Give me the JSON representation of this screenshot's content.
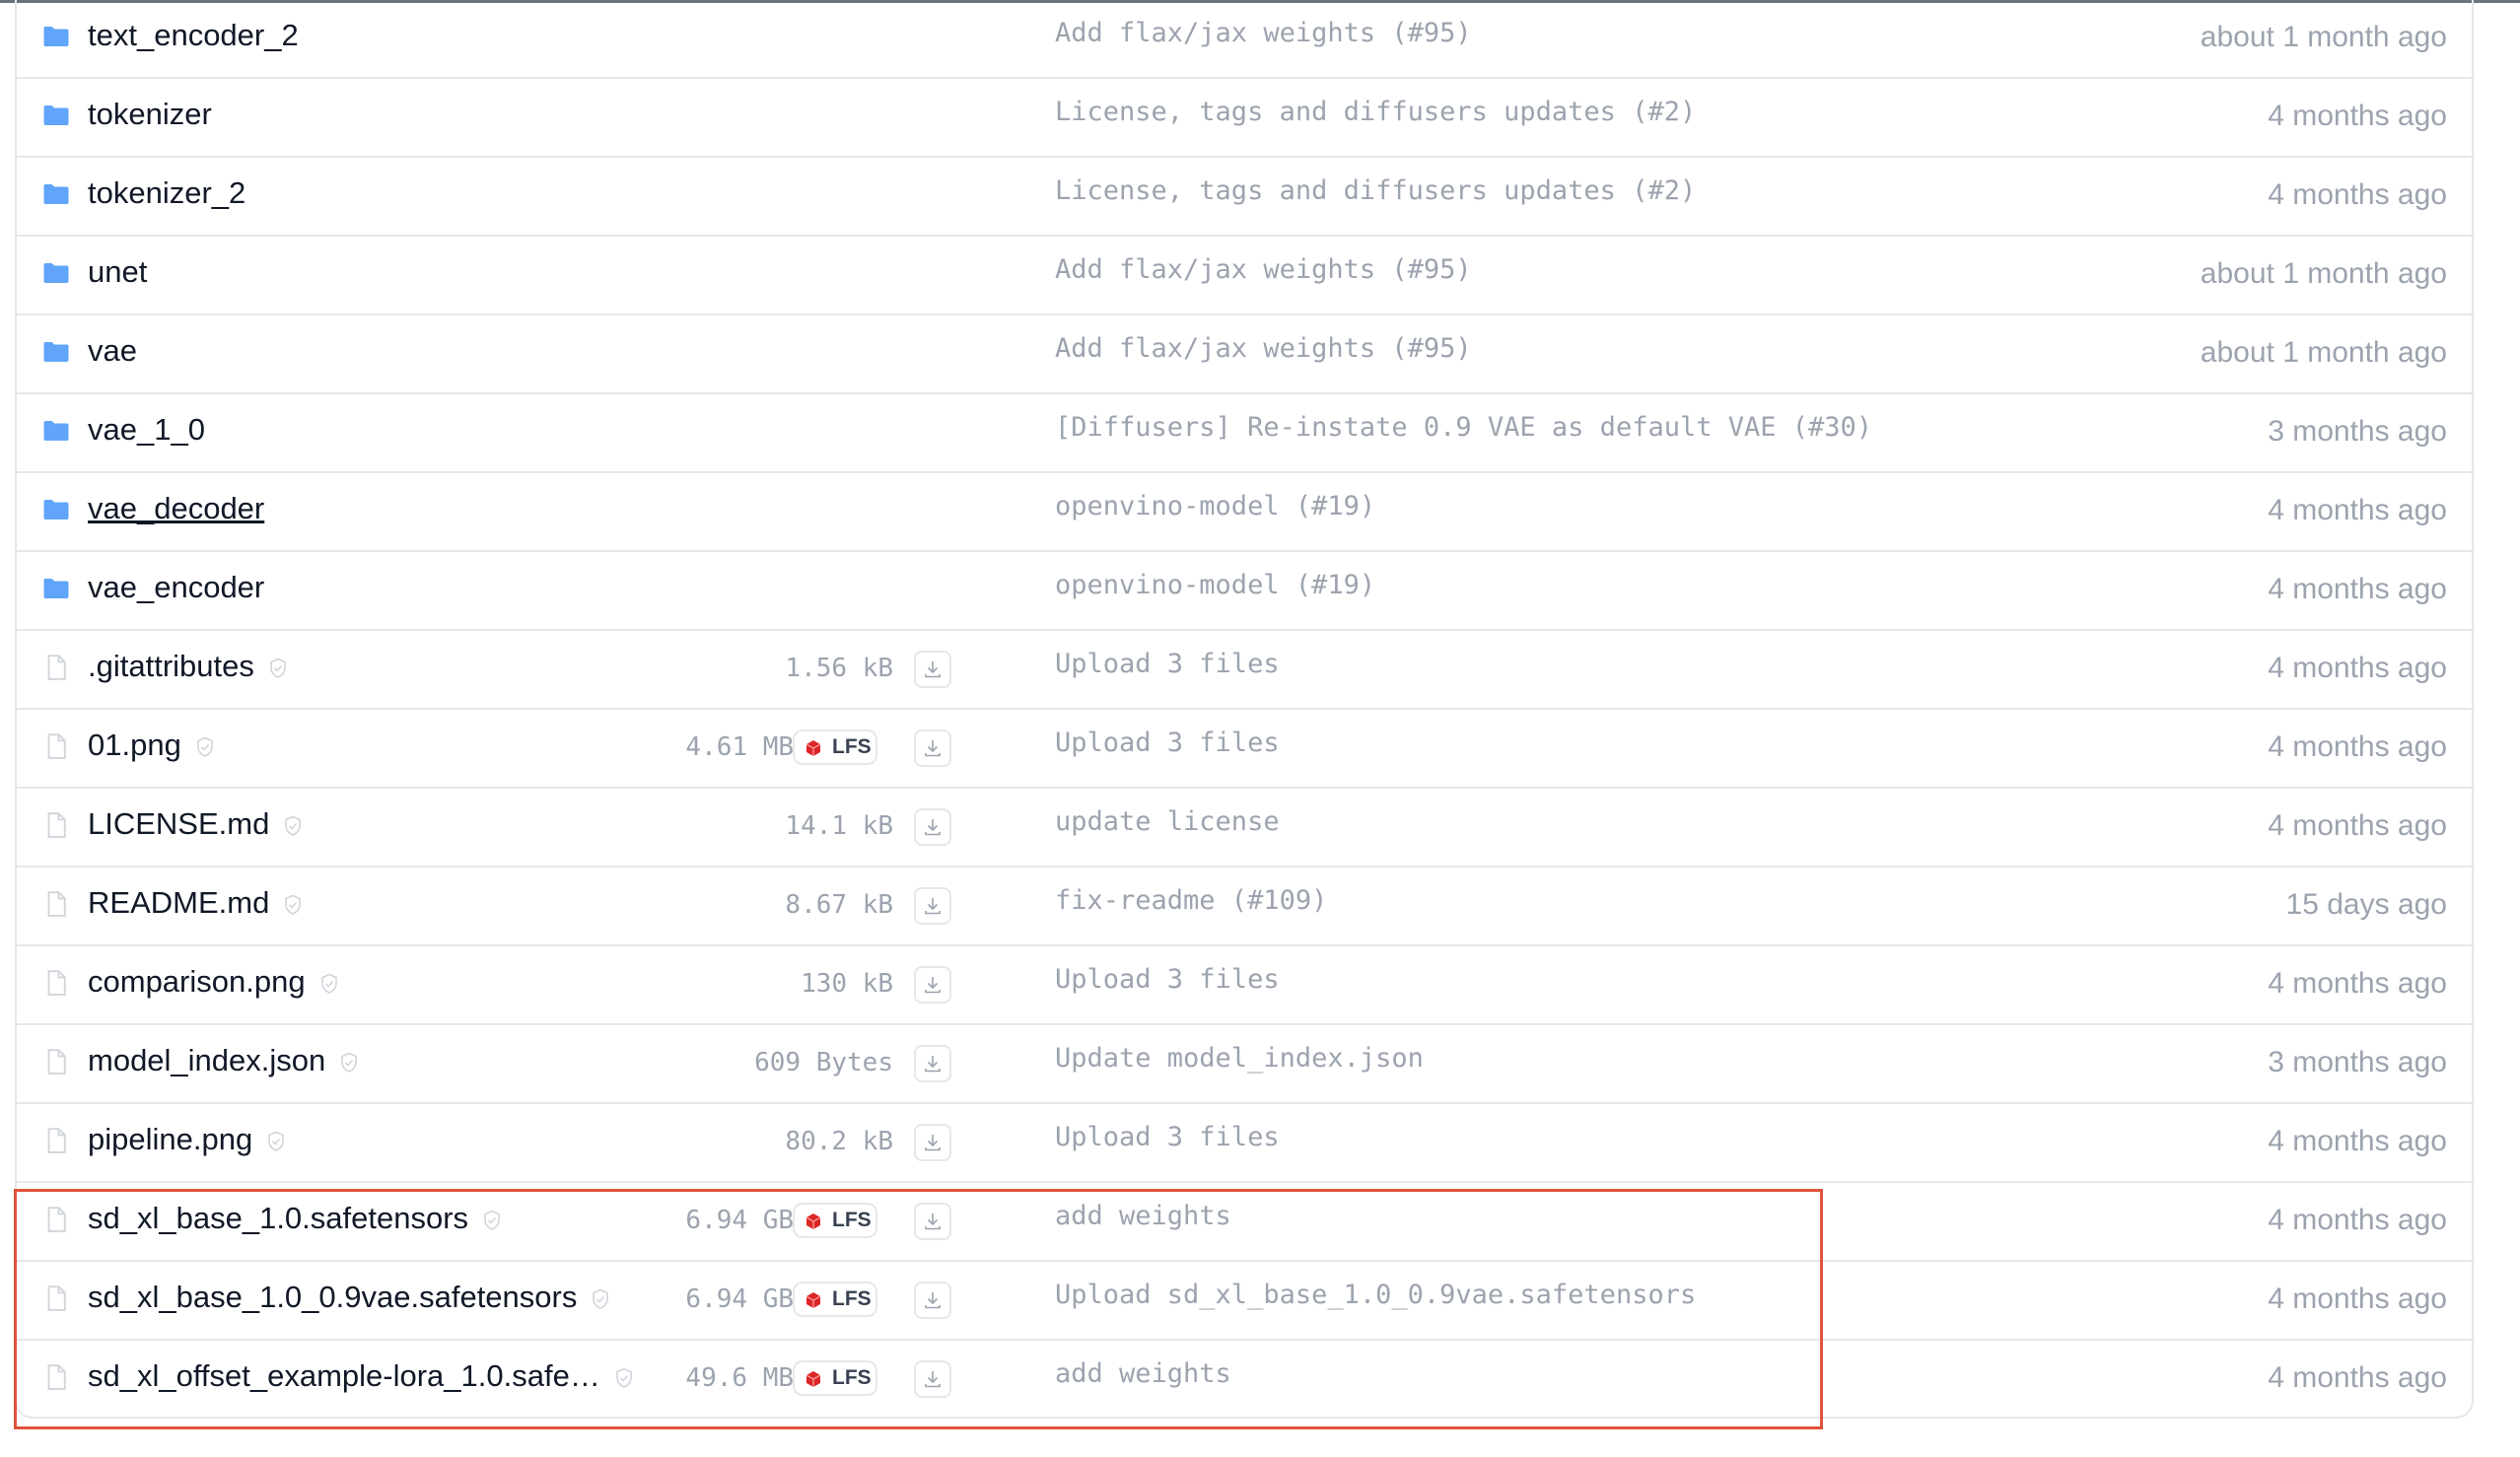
{
  "icons": {
    "folder": "folder-icon",
    "file": "file-icon",
    "shield": "shield-check-icon",
    "lfs": "lfs-icon",
    "download": "download-icon"
  },
  "colors": {
    "folder": "#60a5fa",
    "highlight": "#e0533c",
    "lfs_icon": "#dc2626"
  },
  "folders": [
    {
      "name": "text_encoder_2",
      "commit": "Add flax/jax weights (#95)",
      "time": "about 1 month ago"
    },
    {
      "name": "tokenizer",
      "commit": "License, tags and diffusers updates (#2)",
      "time": "4 months ago"
    },
    {
      "name": "tokenizer_2",
      "commit": "License, tags and diffusers updates (#2)",
      "time": "4 months ago"
    },
    {
      "name": "unet",
      "commit": "Add flax/jax weights (#95)",
      "time": "about 1 month ago"
    },
    {
      "name": "vae",
      "commit": "Add flax/jax weights (#95)",
      "time": "about 1 month ago"
    },
    {
      "name": "vae_1_0",
      "commit": "[Diffusers] Re-instate 0.9 VAE as default VAE (#30)",
      "time": "3 months ago"
    },
    {
      "name": "vae_decoder",
      "commit": "openvino-model (#19)",
      "time": "4 months ago"
    },
    {
      "name": "vae_encoder",
      "commit": "openvino-model (#19)",
      "time": "4 months ago"
    }
  ],
  "files": [
    {
      "name": ".gitattributes",
      "size": "1.56 kB",
      "lfs": false,
      "commit": "Upload 3 files",
      "time": "4 months ago"
    },
    {
      "name": "01.png",
      "size": "4.61 MB",
      "lfs": true,
      "lfs_label": "LFS",
      "commit": "Upload 3 files",
      "time": "4 months ago"
    },
    {
      "name": "LICENSE.md",
      "size": "14.1 kB",
      "lfs": false,
      "commit": "update license",
      "time": "4 months ago"
    },
    {
      "name": "README.md",
      "size": "8.67 kB",
      "lfs": false,
      "commit": "fix-readme (#109)",
      "time": "15 days ago"
    },
    {
      "name": "comparison.png",
      "size": "130 kB",
      "lfs": false,
      "commit": "Upload 3 files",
      "time": "4 months ago"
    },
    {
      "name": "model_index.json",
      "size": "609 Bytes",
      "lfs": false,
      "commit": "Update model_index.json",
      "time": "3 months ago"
    },
    {
      "name": "pipeline.png",
      "size": "80.2 kB",
      "lfs": false,
      "commit": "Upload 3 files",
      "time": "4 months ago"
    },
    {
      "name": "sd_xl_base_1.0.safetensors",
      "size": "6.94 GB",
      "lfs": true,
      "lfs_label": "LFS",
      "commit": "add weights",
      "time": "4 months ago"
    },
    {
      "name": "sd_xl_base_1.0_0.9vae.safetensors",
      "size": "6.94 GB",
      "lfs": true,
      "lfs_label": "LFS",
      "commit": "Upload sd_xl_base_1.0_0.9vae.safetensors",
      "time": "4 months ago"
    },
    {
      "name": "sd_xl_offset_example-lora_1.0.safe…",
      "size": "49.6 MB",
      "lfs": true,
      "lfs_label": "LFS",
      "commit": "add weights",
      "time": "4 months ago"
    }
  ]
}
